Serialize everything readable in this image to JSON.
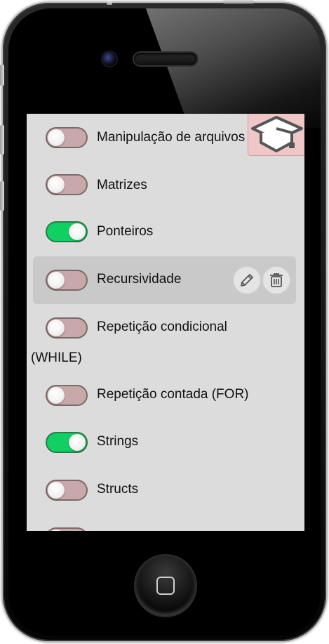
{
  "list": {
    "items": [
      {
        "label": "Manipulação de arquivos",
        "enabled": false
      },
      {
        "label": "Matrizes",
        "enabled": false
      },
      {
        "label": "Ponteiros",
        "enabled": true
      },
      {
        "label": "Recursividade",
        "enabled": false
      },
      {
        "label": "Repetição condicional",
        "label_continued": "(WHILE)",
        "enabled": false
      },
      {
        "label": "Repetição contada (FOR)",
        "enabled": false
      },
      {
        "label": "Strings",
        "enabled": true
      },
      {
        "label": "Structs",
        "enabled": false
      }
    ]
  },
  "actions": {
    "edit_icon": "pencil-icon",
    "delete_icon": "trash-icon"
  },
  "logo": {
    "icon": "graduation-cap-icon"
  },
  "colors": {
    "screen_bg": "#dcdcdc",
    "toggle_off": "#c8a8a8",
    "toggle_on": "#11d063",
    "logo_bg": "#f0c6c6"
  }
}
